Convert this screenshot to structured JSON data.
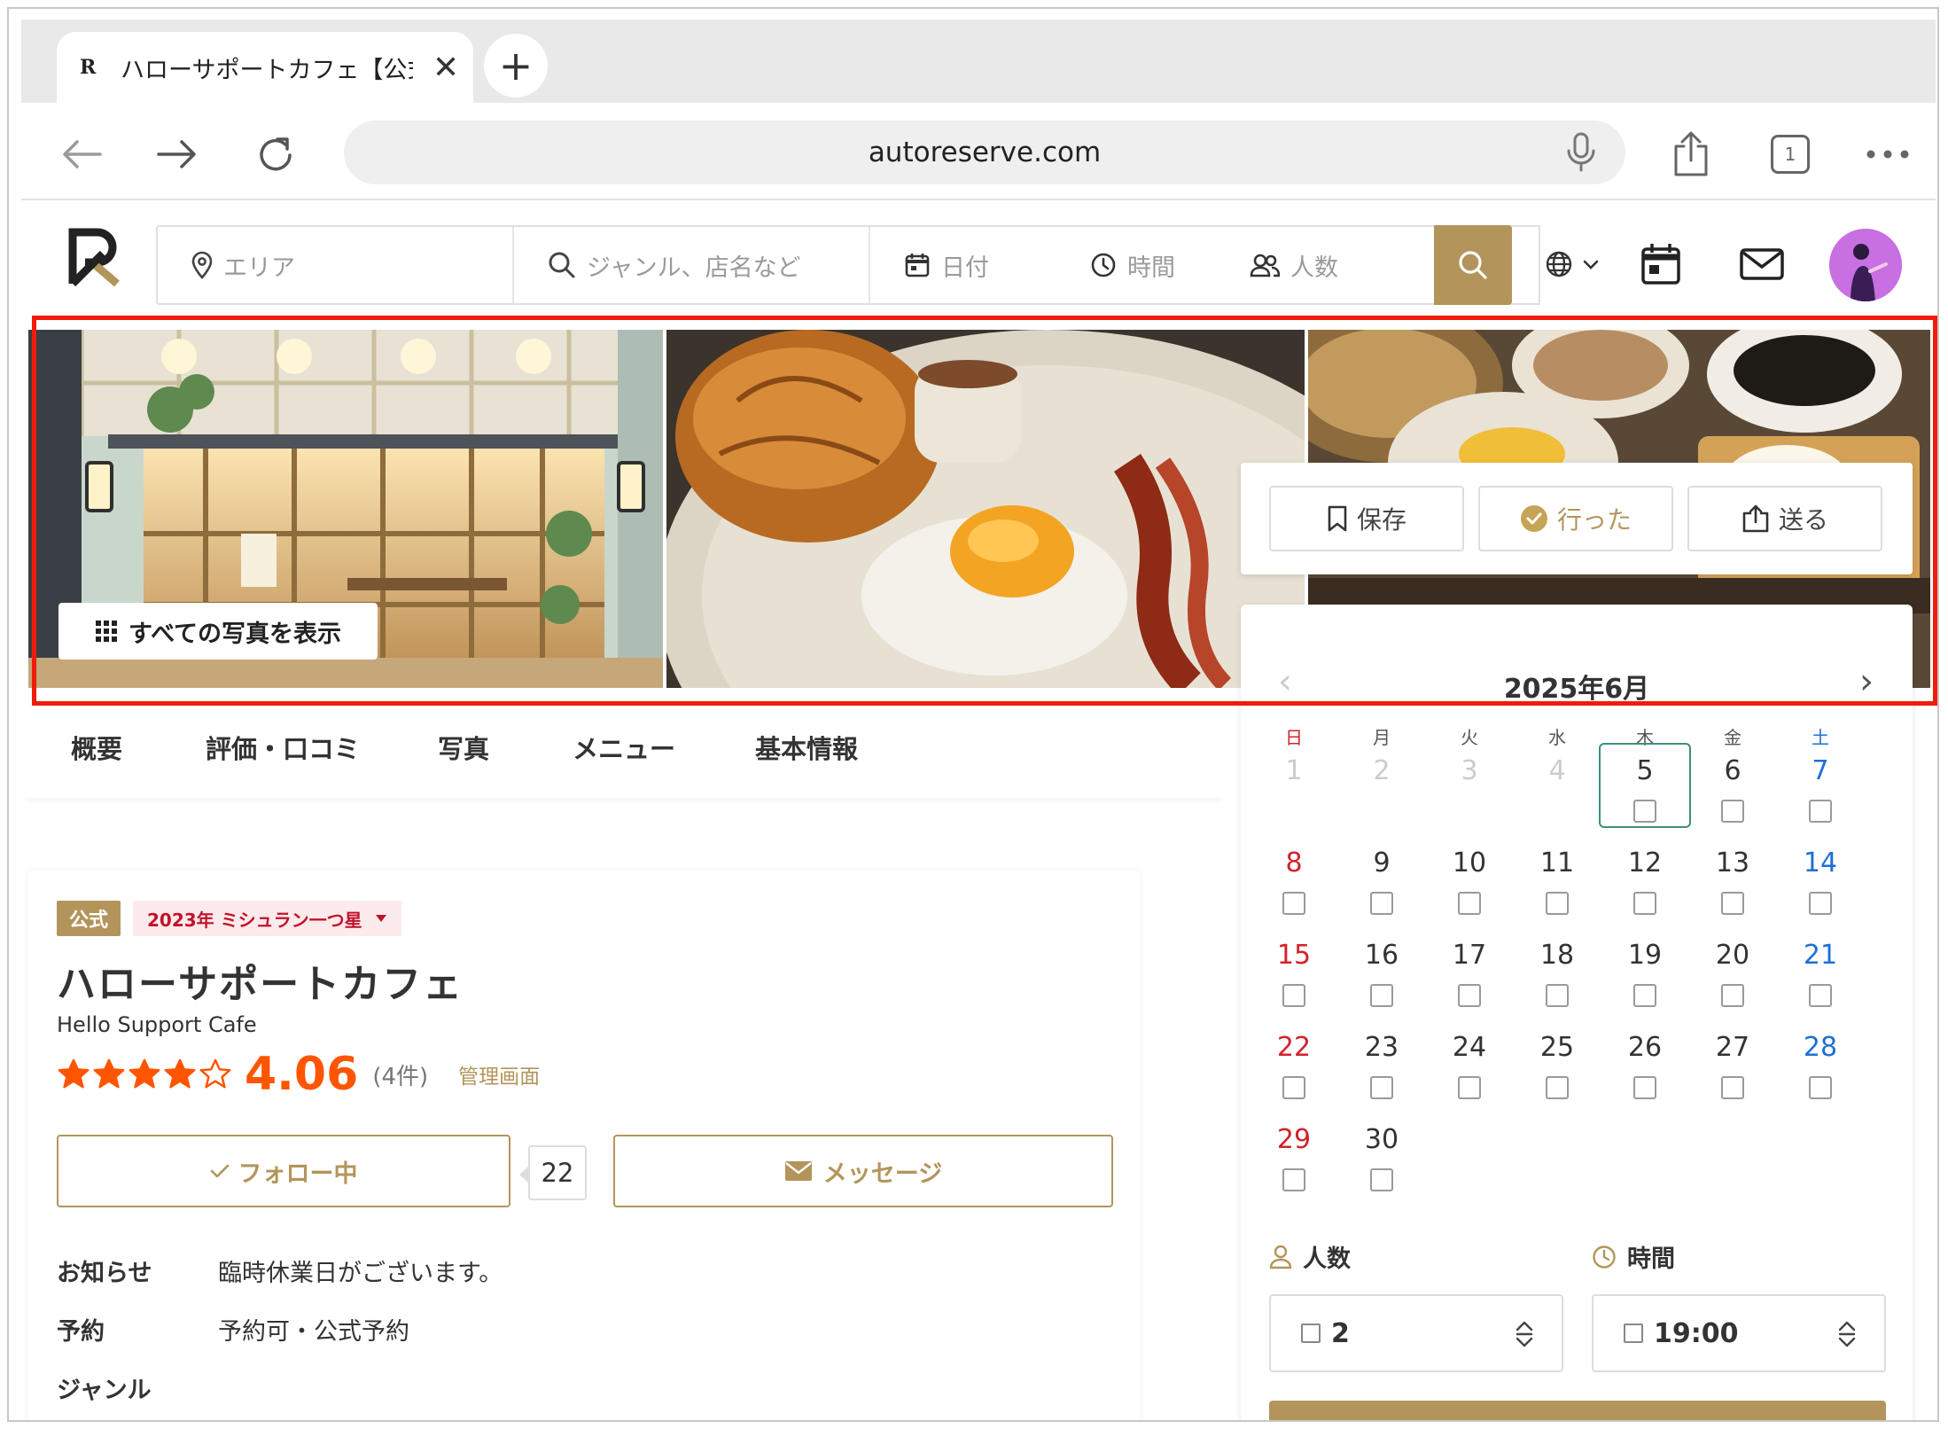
{
  "browser": {
    "tab_title": "ハローサポートカフェ【公式】",
    "favicon": "R",
    "url": "autoreserve.com",
    "tab_count": "1"
  },
  "header": {
    "search": {
      "area_placeholder": "エリア",
      "genre_placeholder": "ジャンル、店名など",
      "date_label": "日付",
      "time_label": "時間",
      "people_label": "人数"
    },
    "icons": [
      "globe-icon",
      "calendar-icon",
      "mail-icon"
    ]
  },
  "hero": {
    "show_all_photos": "すべての写真を表示"
  },
  "actions": {
    "save": "保存",
    "visited": "行った",
    "send": "送る"
  },
  "calendar": {
    "month": "2025年6月",
    "weekdays": [
      "日",
      "月",
      "火",
      "水",
      "木",
      "金",
      "土"
    ],
    "first_weekday": 0,
    "days_in_month": 30,
    "past_days": [
      1,
      2,
      3,
      4
    ],
    "today": 5,
    "colors": {
      "sunday": "#d2232a",
      "saturday": "#1f6fd6",
      "past": "#cccccc",
      "today_border": "#3e8f7b"
    }
  },
  "booking": {
    "people_label": "人数",
    "people_value": "2",
    "time_label": "時間",
    "time_value": "19:00"
  },
  "subnav": [
    "概要",
    "評価・口コミ",
    "写真",
    "メニュー",
    "基本情報"
  ],
  "shop": {
    "badge_official": "公式",
    "badge_michelin": "2023年 ミシュラン一つ星",
    "name": "ハローサポートカフェ",
    "name_en": "Hello Support Cafe",
    "rating": "4.06",
    "rating_stars": 4,
    "review_count": "(4件)",
    "admin_link": "管理画面",
    "follow_label": "フォロー中",
    "follow_count": "22",
    "message_label": "メッセージ",
    "info": [
      {
        "key": "お知らせ",
        "value": "臨時休業日がございます。"
      },
      {
        "key": "予約",
        "value": "予約可・公式予約"
      },
      {
        "key": "ジャンル",
        "value": ""
      }
    ]
  },
  "colors": {
    "accent": "#b3955b",
    "rating": "#ff5500",
    "highlight": "#f01c0a"
  }
}
